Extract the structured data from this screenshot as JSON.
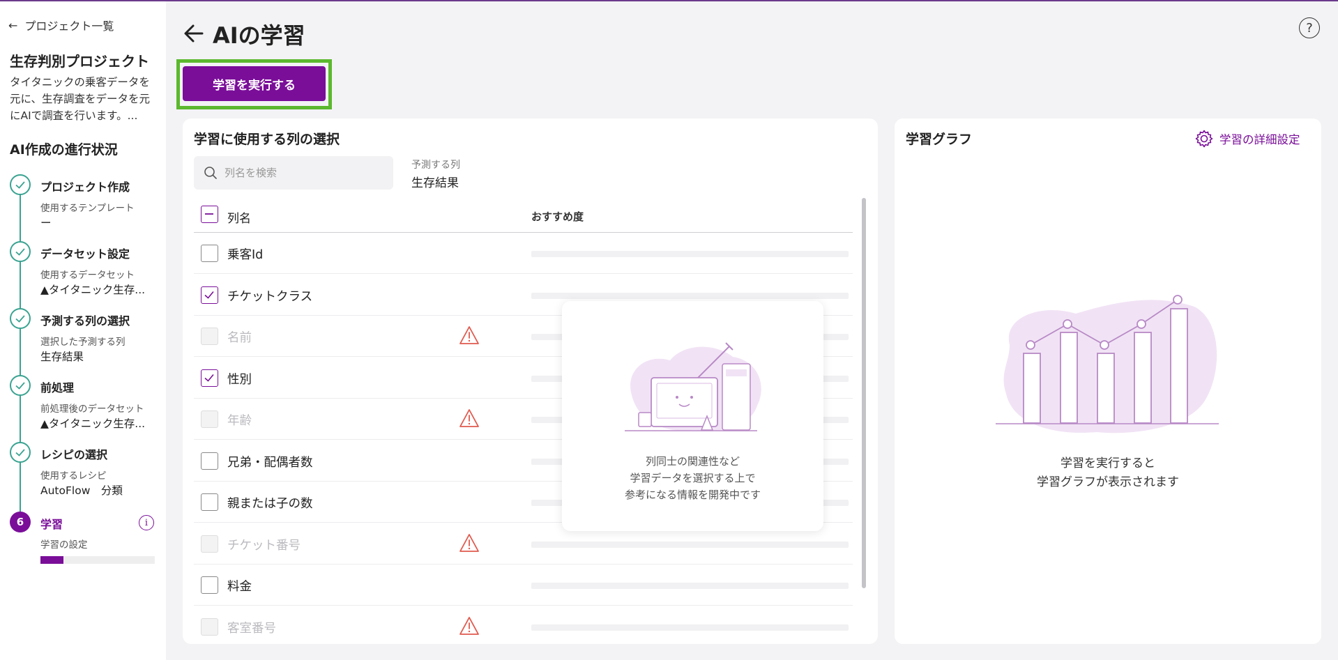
{
  "sidebar": {
    "back_label": "プロジェクト一覧",
    "project_title": "生存判別プロジェクト",
    "project_desc": "タイタニックの乗客データを元に、生存調査をデータを元にAIで調査を行います。...",
    "progress_title": "AI作成の進行状況",
    "steps": [
      {
        "title": "プロジェクト作成",
        "sub": "使用するテンプレート",
        "value": "ー"
      },
      {
        "title": "データセット設定",
        "sub": "使用するデータセット",
        "value": "▲タイタニック生存..."
      },
      {
        "title": "予測する列の選択",
        "sub": "選択した予測する列",
        "value": "生存結果"
      },
      {
        "title": "前処理",
        "sub": "前処理後のデータセット",
        "value": "▲タイタニック生存..."
      },
      {
        "title": "レシピの選択",
        "sub": "使用するレシピ",
        "value": "AutoFlow　分類"
      },
      {
        "number": "6",
        "title": "学習",
        "sub": "学習の設定",
        "progress": 0.2
      }
    ]
  },
  "header": {
    "title": "AIの学習",
    "run_button": "学習を実行する",
    "help": "?"
  },
  "columns_panel": {
    "title": "学習に使用する列の選択",
    "search_placeholder": "列名を検索",
    "predict_label": "予測する列",
    "predict_value": "生存結果",
    "header_name": "列名",
    "header_recommend": "おすすめ度",
    "rows": [
      {
        "name": "乗客Id",
        "state": "unchecked",
        "warning": false
      },
      {
        "name": "チケットクラス",
        "state": "checked",
        "warning": false
      },
      {
        "name": "名前",
        "state": "disabled",
        "warning": true
      },
      {
        "name": "性別",
        "state": "checked",
        "warning": false
      },
      {
        "name": "年齢",
        "state": "disabled",
        "warning": true
      },
      {
        "name": "兄弟・配偶者数",
        "state": "unchecked",
        "warning": false
      },
      {
        "name": "親または子の数",
        "state": "unchecked",
        "warning": false
      },
      {
        "name": "チケット番号",
        "state": "disabled",
        "warning": true
      },
      {
        "name": "料金",
        "state": "unchecked",
        "warning": false
      },
      {
        "name": "客室番号",
        "state": "disabled",
        "warning": true
      }
    ],
    "dev_notice": [
      "列同士の関連性など",
      "学習データを選択する上で",
      "参考になる情報を開発中です"
    ]
  },
  "graph_panel": {
    "title": "学習グラフ",
    "settings_label": "学習の詳細設定",
    "message": [
      "学習を実行すると",
      "学習グラフが表示されます"
    ]
  },
  "colors": {
    "brand": "#7a0e99",
    "step_done": "#3aa391",
    "highlight": "#5cb82e",
    "warning": "#e05a4e"
  }
}
